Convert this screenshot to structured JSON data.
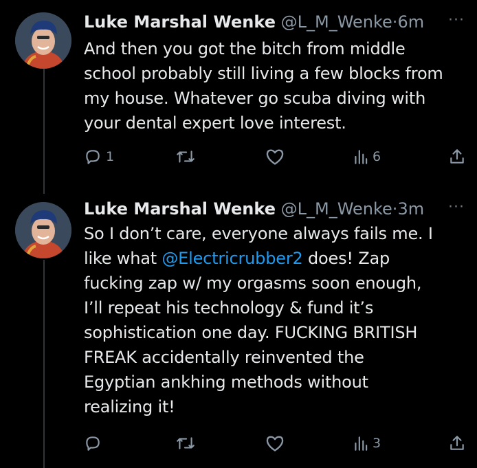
{
  "tweets": [
    {
      "name": "Luke Marshal Wenke",
      "handle": "@L_M_Wenke",
      "separator": "·",
      "time": "6m",
      "more": "···",
      "text_lines": [
        "And then you got the bitch from middle",
        "school probably still living a few blocks from",
        "my house.  Whatever go scuba diving with",
        "your dental expert love interest."
      ],
      "reply_count": "1",
      "retweet_count": "",
      "like_count": "",
      "view_count": "6"
    },
    {
      "name": "Luke Marshal Wenke",
      "handle": "@L_M_Wenke",
      "separator": "·",
      "time": "3m",
      "more": "···",
      "line1": "So I don’t care, everyone always fails me. I",
      "line2_pre": "like what ",
      "mention": "@Electricrubber2",
      "line2_post": " does! Zap",
      "text_lines_rest": [
        "fucking zap w/ my orgasms soon enough,",
        "I’ll repeat his technology & fund it’s",
        "sophistication one day. FUCKING BRITISH",
        "FREAK accidentally reinvented the",
        "Egyptian ankhing methods without",
        "realizing it!"
      ],
      "reply_count": "",
      "retweet_count": "",
      "like_count": "",
      "view_count": "3"
    }
  ],
  "colors": {
    "background": "#000000",
    "text": "#e7e9ea",
    "secondary": "#8b98a5",
    "mention": "#1d9bf0",
    "thread_line": "#333639"
  },
  "icons": [
    "reply-icon",
    "retweet-icon",
    "like-icon",
    "views-icon",
    "share-icon",
    "more-icon"
  ]
}
